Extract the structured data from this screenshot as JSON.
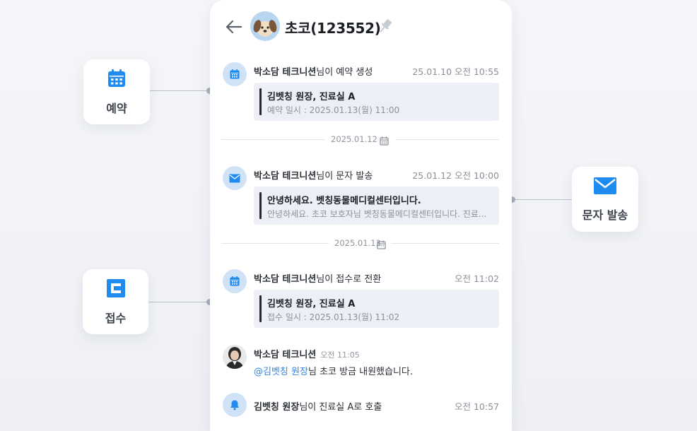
{
  "pet": {
    "name": "초코(123552)"
  },
  "side_cards": {
    "reservation": {
      "label": "예약",
      "icon": "calendar-icon"
    },
    "message": {
      "label": "문자 발송",
      "icon": "mail-icon"
    },
    "reception": {
      "label": "접수",
      "icon": "reception-icon"
    }
  },
  "feed": {
    "item1": {
      "actor": "박소담 테크니션",
      "action": "님이 예약 생성",
      "time": "25.01.10 오전 10:55",
      "quote_title": "김벳칭 원장, 진료실 A",
      "quote_sub": "예약 일시 : 2025.01.13(월) 11:00"
    },
    "divider1": {
      "date": "2025.01.12"
    },
    "item2": {
      "actor": "박소담 테크니션",
      "action": "님이 문자 발송",
      "time": "25.01.12 오전 10:00",
      "quote_title": "안녕하세요. 벳칭동물메디컬센터입니다.",
      "quote_sub": "안녕하세요. 초코 보호자님 벳칭동물메디컬센터입니다. 진료..."
    },
    "divider2": {
      "date": "2025.01.13"
    },
    "item3": {
      "actor": "박소담 테크니션",
      "action": "님이 접수로 전환",
      "time": "오전 11:02",
      "quote_title": "김벳칭 원장, 진료실 A",
      "quote_sub": "접수 일시 : 2025.01.13(월) 11:02"
    },
    "item4": {
      "actor": "박소담 테크니션",
      "time": "오전 11:05",
      "mention": "@김벳칭 원장",
      "message": "님 초코 방금 내원했습니다."
    },
    "item5": {
      "actor": "김벳칭 원장",
      "action": "님이 진료실 A로 호출",
      "time": "오전 10:57"
    }
  },
  "colors": {
    "accent": "#1f8bf0",
    "icon_bg": "#cfe2f6",
    "mention": "#2f86e6"
  }
}
